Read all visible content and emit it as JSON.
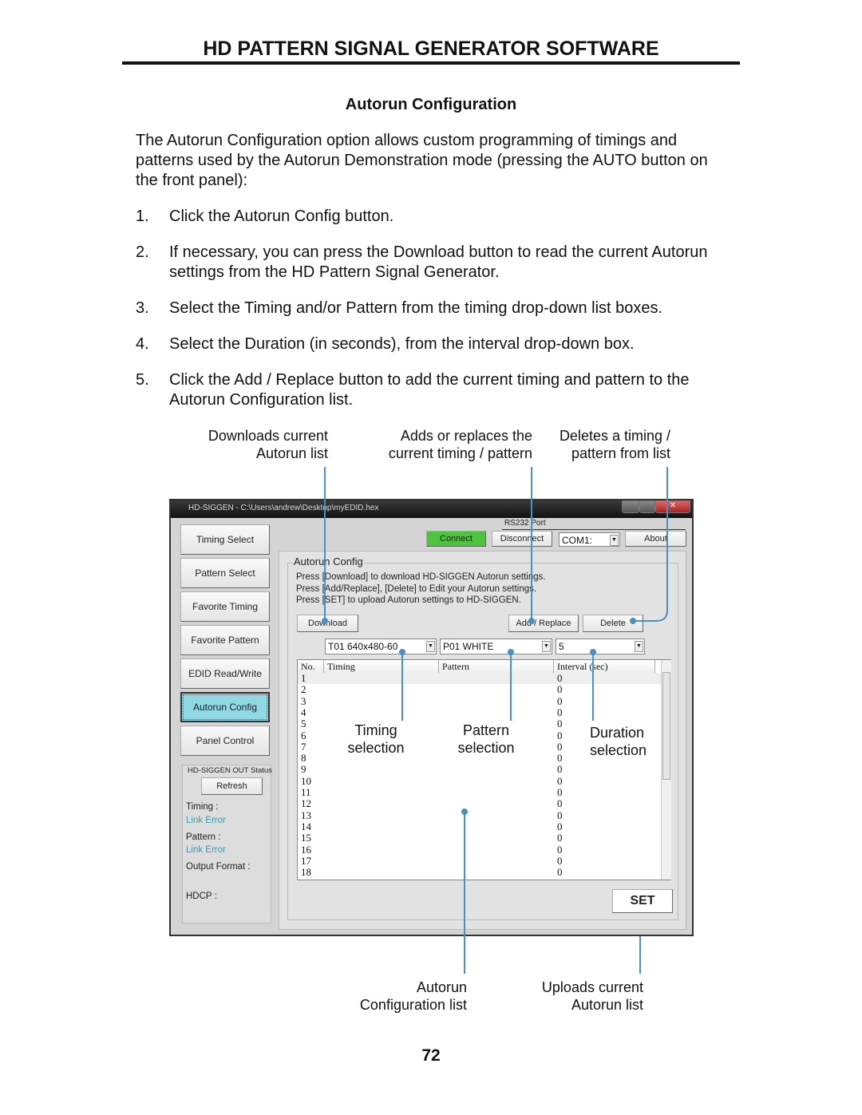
{
  "header": {
    "title": "HD PATTERN SIGNAL GENERATOR SOFTWARE",
    "section": "Autorun Configuration"
  },
  "intro": [
    "The Autorun Configuration option allows custom programming of timings and",
    "patterns used by the Autorun Demonstration mode (pressing the AUTO button on",
    "the front panel):"
  ],
  "steps": [
    {
      "num": "1.",
      "lines": [
        "Click the Autorun Config button."
      ]
    },
    {
      "num": "2.",
      "lines": [
        "If necessary, you can press the Download button to read the current Autorun",
        "settings from the HD Pattern Signal Generator."
      ]
    },
    {
      "num": "3.",
      "lines": [
        "Select the Timing and/or Pattern from the timing drop-down list boxes."
      ]
    },
    {
      "num": "4.",
      "lines": [
        "Select the Duration (in seconds), from the interval drop-down box."
      ]
    },
    {
      "num": "5.",
      "lines": [
        "Click the Add / Replace button to add the current timing and pattern to the",
        "Autorun Configuration list."
      ]
    }
  ],
  "callouts": {
    "download": [
      "Downloads current",
      "Autorun list"
    ],
    "add": [
      "Adds or replaces the",
      "current timing / pattern"
    ],
    "delete": [
      "Deletes a timing /",
      "pattern from list"
    ],
    "timing": [
      "Timing",
      "selection"
    ],
    "pattern": [
      "Pattern",
      "selection"
    ],
    "duration": [
      "Duration",
      "selection"
    ],
    "list": [
      "Autorun",
      "Configuration list"
    ],
    "upload": [
      "Uploads current",
      "Autorun list"
    ],
    "line_color": "#4a90c4"
  },
  "app": {
    "title": "HD-SIGGEN  - C:\\Users\\andrew\\Desktop\\myEDID.hex",
    "nav": [
      "Timing Select",
      "Pattern Select",
      "Favorite Timing",
      "Favorite Pattern",
      "EDID Read/Write",
      "Autorun Config",
      "Panel Control"
    ],
    "active_nav": "Autorun Config",
    "rs232": {
      "label": "RS232 Port",
      "connect": "Connect",
      "disconnect": "Disconnect",
      "port": "COM1:",
      "about": "About"
    },
    "status": {
      "title": "HD-SIGGEN OUT Status",
      "refresh": "Refresh",
      "timing_label": "Timing :",
      "timing_value": "Link Error",
      "pattern_label": "Pattern :",
      "pattern_value": "Link Error",
      "output_label": "Output Format :",
      "hdcp_label": "HDCP :"
    },
    "autorun": {
      "title": "Autorun Config",
      "help": [
        "Press [Download] to download HD-SIGGEN Autorun settings.",
        "Press [Add/Replace], [Delete] to Edit your Autorun settings.",
        "Press [SET] to upload Autorun settings to HD-SIGGEN."
      ],
      "download": "Download",
      "add_replace": "Add / Replace",
      "delete": "Delete",
      "timing_select": "T01 640x480-60",
      "pattern_select": "P01 WHITE",
      "interval_select": "5",
      "columns": [
        "No.",
        "Timing",
        "Pattern",
        "Interval (sec)"
      ],
      "rows": [
        [
          "1",
          "",
          "",
          "0"
        ],
        [
          "2",
          "",
          "",
          "0"
        ],
        [
          "3",
          "",
          "",
          "0"
        ],
        [
          "4",
          "",
          "",
          "0"
        ],
        [
          "5",
          "",
          "",
          "0"
        ],
        [
          "6",
          "",
          "",
          "0"
        ],
        [
          "7",
          "",
          "",
          "0"
        ],
        [
          "8",
          "",
          "",
          "0"
        ],
        [
          "9",
          "",
          "",
          "0"
        ],
        [
          "10",
          "",
          "",
          "0"
        ],
        [
          "11",
          "",
          "",
          "0"
        ],
        [
          "12",
          "",
          "",
          "0"
        ],
        [
          "13",
          "",
          "",
          "0"
        ],
        [
          "14",
          "",
          "",
          "0"
        ],
        [
          "15",
          "",
          "",
          "0"
        ],
        [
          "16",
          "",
          "",
          "0"
        ],
        [
          "17",
          "",
          "",
          "0"
        ],
        [
          "18",
          "",
          "",
          "0"
        ]
      ],
      "set": "SET"
    },
    "colors": {
      "connect": "#4cc43c",
      "active": "#8fd8e4",
      "link_error": "#3a9aa8"
    }
  },
  "page_number": "72"
}
